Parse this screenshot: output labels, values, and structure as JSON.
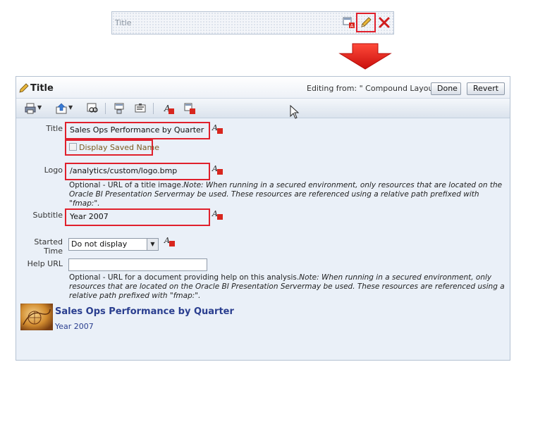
{
  "top_bar": {
    "title": "Title"
  },
  "panel": {
    "title": "Title",
    "editing_from": "Editing from: \" Compound Layout\"",
    "done_label": "Done",
    "revert_label": "Revert"
  },
  "form": {
    "title_label": "Title",
    "title_value": "Sales Ops Performance by Quarter",
    "display_saved_name_label": "Display Saved Name",
    "logo_label": "Logo",
    "logo_value": "/analytics/custom/logo.bmp",
    "logo_help_plain": "Optional - URL of a title image.",
    "logo_help_italic": "Note: When running in a secured environment, only resources that are located on the Oracle BI Presentation Servermay be used. These resources are referenced using a relative path prefixed with \"fmap:\".",
    "subtitle_label": "Subtitle",
    "subtitle_value": "Year 2007",
    "started_time_label": "Started Time",
    "started_time_value": "Do not display",
    "help_url_label": "Help URL",
    "help_url_value": "",
    "help_url_help_plain": "Optional - URL for a document providing help on this analysis.",
    "help_url_help_italic": "Note: When running in a secured environment, only resources that are located on the Oracle BI Presentation Servermay be used. These resources are referenced using a relative path prefixed with \"fmap:\"."
  },
  "preview": {
    "title": "Sales Ops Performance by Quarter",
    "subtitle": "Year 2007"
  },
  "icons": {
    "top_bar": [
      "format-view-icon",
      "edit-pencil-icon",
      "delete-x-icon"
    ],
    "toolbar": [
      "print-icon",
      "export-icon",
      "preview-icon",
      "refresh-icon",
      "properties-icon",
      "format-text-icon",
      "clear-format-icon"
    ]
  },
  "colors": {
    "highlight_red": "#e0202c",
    "arrow_red": "#e8201c",
    "preview_blue": "#2a3e8f"
  }
}
